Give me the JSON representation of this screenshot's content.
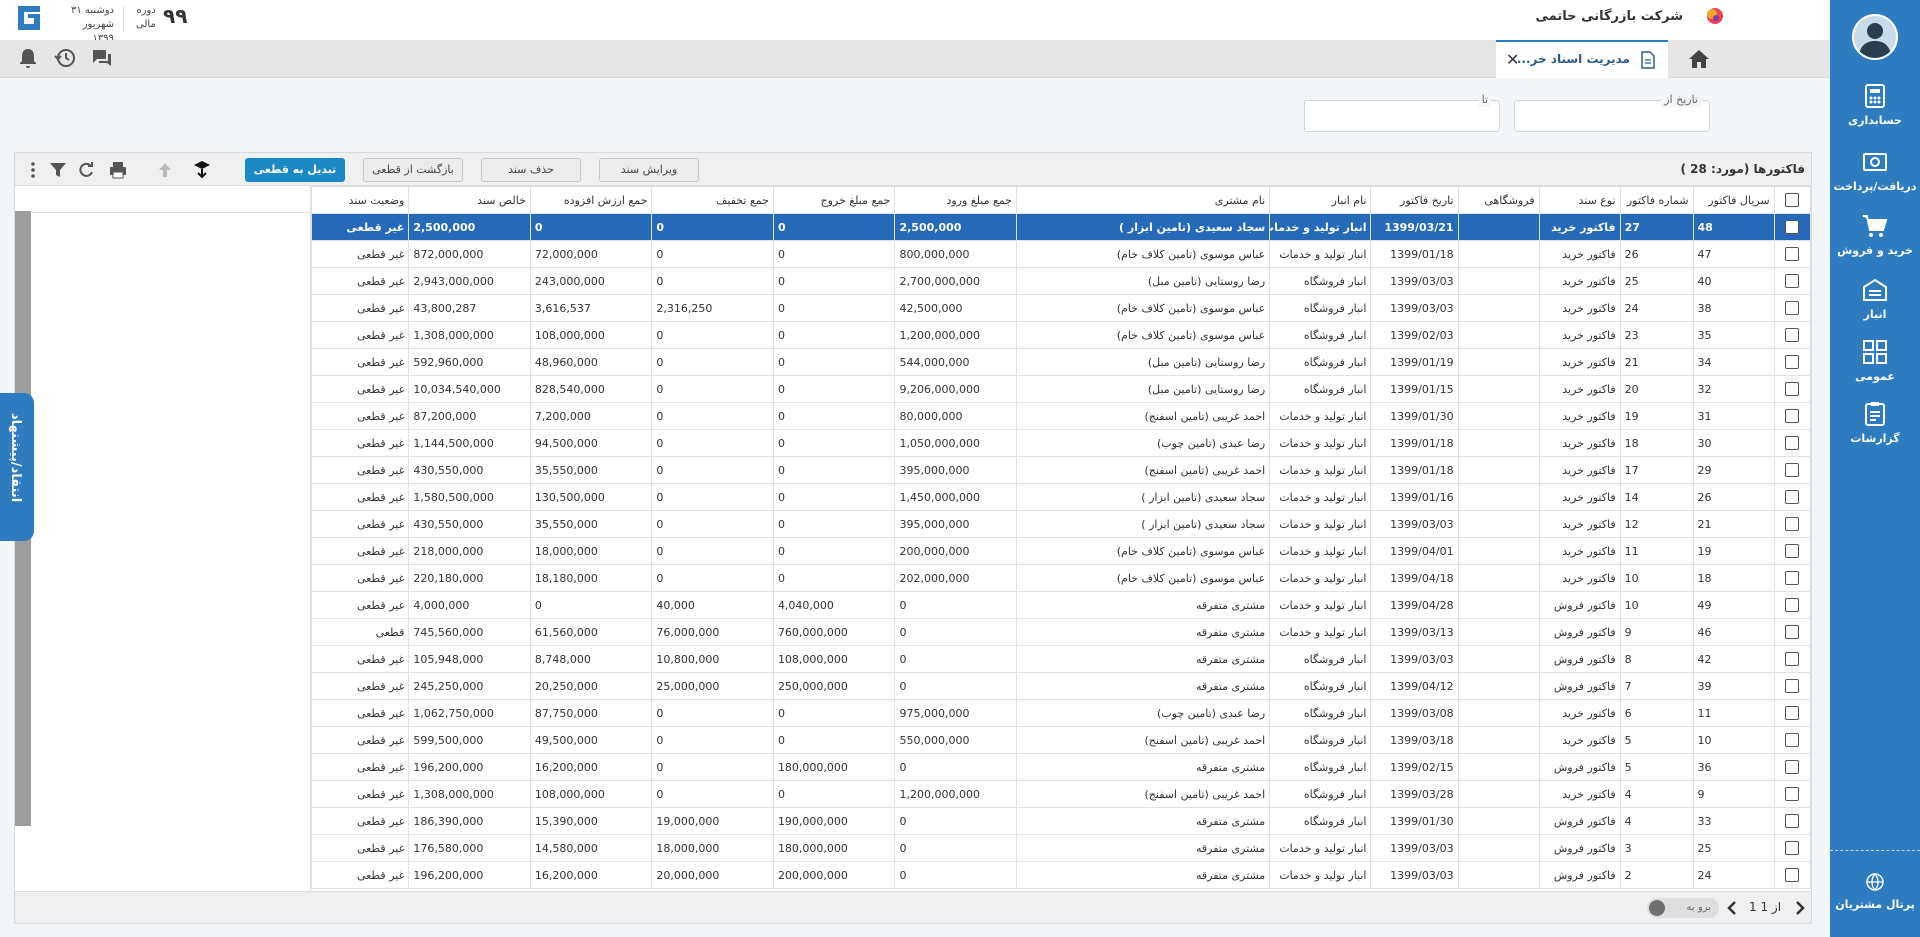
{
  "header": {
    "company_name": "شرکت بازرگانی حاتمی",
    "period_label_1": "دوره",
    "period_label_2": "مالی",
    "period_number": "۹۹",
    "weekday": "دوشنبه ۳۱",
    "month_year": "شهریور ۱۳۹۹"
  },
  "tabs": [
    {
      "label": "مدیریت اسناد خر..."
    }
  ],
  "sidebar": {
    "items": [
      {
        "label": "حسابداری",
        "icon": "accounting-icon"
      },
      {
        "label": "دریافت/پرداخت",
        "icon": "cash-icon"
      },
      {
        "label": "خرید و فروش",
        "icon": "cart-icon"
      },
      {
        "label": "انبار",
        "icon": "warehouse-icon"
      },
      {
        "label": "عمومی",
        "icon": "grid-icon"
      },
      {
        "label": "گزارشات",
        "icon": "clipboard-icon"
      }
    ],
    "portal_label": "پرتال مشتریان"
  },
  "filter": {
    "date_from_label": "تاریخ از",
    "date_to_label": "تا",
    "date_from_value": "",
    "date_to_value": ""
  },
  "toolbar": {
    "title_prefix": "فاکتورها (مورد:",
    "count": "28",
    "title_suffix": ")",
    "edit_label": "ویرایش سند",
    "delete_label": "حذف سند",
    "revert_label": "بازگشت از قطعی",
    "finalize_label": "تبدیل به قطعی"
  },
  "columns": [
    "",
    "سریال فاکتور",
    "شماره فاکتور",
    "نوع سند",
    "فروشگاهی",
    "تاریخ فاکتور",
    "نام انبار",
    "نام مشتری",
    "جمع مبلغ ورود",
    "جمع مبلغ خروج",
    "جمع تخفیف",
    "جمع ارزش افزوده",
    "خالص سند",
    "وضعیت سند"
  ],
  "rows": [
    [
      "48",
      "27",
      "فاکتور خرید",
      "",
      "1399/03/21",
      "انبار تولید و خدمات",
      "سجاد سعیدی (تامین ابزار )",
      "2,500,000",
      "0",
      "0",
      "0",
      "2,500,000",
      "غیر قطعی"
    ],
    [
      "47",
      "26",
      "فاکتور خرید",
      "",
      "1399/01/18",
      "انبار تولید و خدمات",
      "عباس موسوی (تامین کلاف خام)",
      "800,000,000",
      "0",
      "0",
      "72,000,000",
      "872,000,000",
      "غیر قطعی"
    ],
    [
      "40",
      "25",
      "فاکتور خرید",
      "",
      "1399/03/03",
      "انبار فروشگاه",
      "رضا روستایی (تامین مبل)",
      "2,700,000,000",
      "0",
      "0",
      "243,000,000",
      "2,943,000,000",
      "غیر قطعی"
    ],
    [
      "38",
      "24",
      "فاکتور خرید",
      "",
      "1399/03/03",
      "انبار فروشگاه",
      "عباس موسوی (تامین کلاف خام)",
      "42,500,000",
      "0",
      "2,316,250",
      "3,616,537",
      "43,800,287",
      "غیر قطعی"
    ],
    [
      "35",
      "23",
      "فاکتور خرید",
      "",
      "1399/02/03",
      "انبار فروشگاه",
      "عباس موسوی (تامین کلاف خام)",
      "1,200,000,000",
      "0",
      "0",
      "108,000,000",
      "1,308,000,000",
      "غیر قطعی"
    ],
    [
      "34",
      "21",
      "فاکتور خرید",
      "",
      "1399/01/19",
      "انبار فروشگاه",
      "رضا روستایی (تامین مبل)",
      "544,000,000",
      "0",
      "0",
      "48,960,000",
      "592,960,000",
      "غیر قطعی"
    ],
    [
      "32",
      "20",
      "فاکتور خرید",
      "",
      "1399/01/15",
      "انبار فروشگاه",
      "رضا روستایی (تامین مبل)",
      "9,206,000,000",
      "0",
      "0",
      "828,540,000",
      "10,034,540,000",
      "غیر قطعی"
    ],
    [
      "31",
      "19",
      "فاکتور خرید",
      "",
      "1399/01/30",
      "انبار تولید و خدمات",
      "احمد غریبی (تامین اسفنج)",
      "80,000,000",
      "0",
      "0",
      "7,200,000",
      "87,200,000",
      "غیر قطعی"
    ],
    [
      "30",
      "18",
      "فاکتور خرید",
      "",
      "1399/01/18",
      "انبار تولید و خدمات",
      "رضا عبدی (تامین چوب)",
      "1,050,000,000",
      "0",
      "0",
      "94,500,000",
      "1,144,500,000",
      "غیر قطعی"
    ],
    [
      "29",
      "17",
      "فاکتور خرید",
      "",
      "1399/01/18",
      "انبار تولید و خدمات",
      "احمد غریبی (تامین اسفنج)",
      "395,000,000",
      "0",
      "0",
      "35,550,000",
      "430,550,000",
      "غیر قطعی"
    ],
    [
      "26",
      "14",
      "فاکتور خرید",
      "",
      "1399/01/16",
      "انبار تولید و خدمات",
      "سجاد سعیدی (تامین ابزار )",
      "1,450,000,000",
      "0",
      "0",
      "130,500,000",
      "1,580,500,000",
      "غیر قطعی"
    ],
    [
      "21",
      "12",
      "فاکتور خرید",
      "",
      "1399/03/03",
      "انبار تولید و خدمات",
      "سجاد سعیدی (تامین ابزار )",
      "395,000,000",
      "0",
      "0",
      "35,550,000",
      "430,550,000",
      "غیر قطعی"
    ],
    [
      "19",
      "11",
      "فاکتور خرید",
      "",
      "1399/04/01",
      "انبار تولید و خدمات",
      "عباس موسوی (تامین کلاف خام)",
      "200,000,000",
      "0",
      "0",
      "18,000,000",
      "218,000,000",
      "غیر قطعی"
    ],
    [
      "18",
      "10",
      "فاکتور خرید",
      "",
      "1399/04/18",
      "انبار تولید و خدمات",
      "عباس موسوی (تامین کلاف خام)",
      "202,000,000",
      "0",
      "0",
      "18,180,000",
      "220,180,000",
      "غیر قطعی"
    ],
    [
      "49",
      "10",
      "فاکتور فروش",
      "",
      "1399/04/28",
      "انبار تولید و خدمات",
      "مشتری متفرقه",
      "0",
      "4,040,000",
      "40,000",
      "0",
      "4,000,000",
      "غیر قطعی"
    ],
    [
      "46",
      "9",
      "فاکتور فروش",
      "",
      "1399/03/13",
      "انبار تولید و خدمات",
      "مشتری متفرقه",
      "0",
      "760,000,000",
      "76,000,000",
      "61,560,000",
      "745,560,000",
      "قطعی"
    ],
    [
      "42",
      "8",
      "فاکتور فروش",
      "",
      "1399/03/03",
      "انبار فروشگاه",
      "مشتری متفرقه",
      "0",
      "108,000,000",
      "10,800,000",
      "8,748,000",
      "105,948,000",
      "غیر قطعی"
    ],
    [
      "39",
      "7",
      "فاکتور فروش",
      "",
      "1399/04/12",
      "انبار فروشگاه",
      "مشتری متفرقه",
      "0",
      "250,000,000",
      "25,000,000",
      "20,250,000",
      "245,250,000",
      "غیر قطعی"
    ],
    [
      "11",
      "6",
      "فاکتور خرید",
      "",
      "1399/03/08",
      "انبار فروشگاه",
      "رضا عبدی (تامین چوب)",
      "975,000,000",
      "0",
      "0",
      "87,750,000",
      "1,062,750,000",
      "غیر قطعی"
    ],
    [
      "10",
      "5",
      "فاکتور خرید",
      "",
      "1399/03/18",
      "انبار فروشگاه",
      "احمد غریبی (تامین اسفنج)",
      "550,000,000",
      "0",
      "0",
      "49,500,000",
      "599,500,000",
      "غیر قطعی"
    ],
    [
      "36",
      "5",
      "فاکتور فروش",
      "",
      "1399/02/15",
      "انبار فروشگاه",
      "مشتری متفرقه",
      "0",
      "180,000,000",
      "0",
      "16,200,000",
      "196,200,000",
      "غیر قطعی"
    ],
    [
      "9",
      "4",
      "فاکتور خرید",
      "",
      "1399/03/28",
      "انبار فروشگاه",
      "احمد غریبی (تامین اسفنج)",
      "1,200,000,000",
      "0",
      "0",
      "108,000,000",
      "1,308,000,000",
      "غیر قطعی"
    ],
    [
      "33",
      "4",
      "فاکتور فروش",
      "",
      "1399/01/30",
      "انبار فروشگاه",
      "مشتری متفرقه",
      "0",
      "190,000,000",
      "19,000,000",
      "15,390,000",
      "186,390,000",
      "غیر قطعی"
    ],
    [
      "25",
      "3",
      "فاکتور فروش",
      "",
      "1399/03/03",
      "انبار تولید و خدمات",
      "مشتری متفرقه",
      "0",
      "180,000,000",
      "18,000,000",
      "14,580,000",
      "176,580,000",
      "غیر قطعی"
    ],
    [
      "24",
      "2",
      "فاکتور فروش",
      "",
      "1399/03/03",
      "انبار تولید و خدمات",
      "مشتری متفرقه",
      "0",
      "200,000,000",
      "20,000,000",
      "16,200,000",
      "196,200,000",
      "غیر قطعی"
    ]
  ],
  "pager": {
    "page_text": "1 از 1",
    "goto_label": "برو به"
  },
  "feedback_label": "انتقاد/پیشنهاد",
  "colors": {
    "primary": "#2e7bbf",
    "selected_row": "#2569b8",
    "button_primary": "#1b89c4"
  }
}
